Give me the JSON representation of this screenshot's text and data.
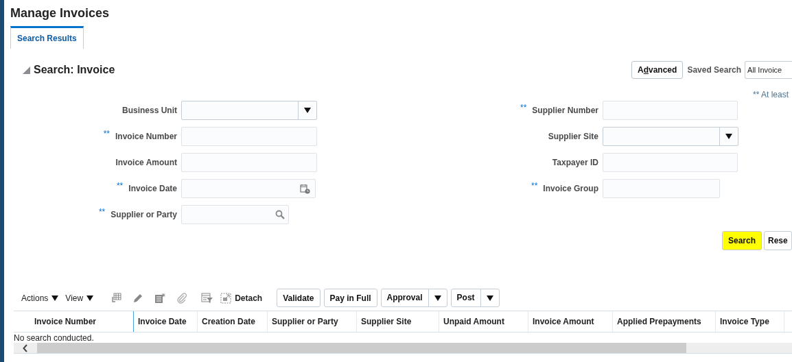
{
  "page_title": "Manage Invoices",
  "tabs": [
    {
      "label": "Search Results",
      "selected": true
    }
  ],
  "search": {
    "title": "Search: Invoice",
    "expanded": true,
    "advanced_button": "Advanced",
    "saved_search_label": "Saved Search",
    "saved_search_value": "All Invoice",
    "hint": "** At least"
  },
  "left_fields": [
    {
      "label": "Business Unit",
      "kind": "select"
    },
    {
      "label": "Invoice Number",
      "kind": "text",
      "required_mark": "**"
    },
    {
      "label": "Invoice Amount",
      "kind": "text"
    },
    {
      "label": "Invoice Date",
      "kind": "date",
      "required_mark": "**"
    },
    {
      "label": "Supplier or Party",
      "kind": "search",
      "required_mark": "**"
    }
  ],
  "right_fields": [
    {
      "label": "Supplier Number",
      "kind": "text",
      "required_mark": "**"
    },
    {
      "label": "Supplier Site",
      "kind": "select"
    },
    {
      "label": "Taxpayer ID",
      "kind": "text"
    },
    {
      "label": "Invoice Group",
      "kind": "text",
      "required_mark": "**"
    }
  ],
  "search_buttons": [
    {
      "label": "Search",
      "highlighted": true
    },
    {
      "label": "Rese",
      "highlighted": false
    }
  ],
  "toolbar": {
    "menus": [
      "Actions",
      "View"
    ],
    "detach": "Detach",
    "buttons": [
      {
        "label": "Validate",
        "kind": "plain"
      },
      {
        "label": "Pay in Full",
        "kind": "plain"
      },
      {
        "label": "Approval",
        "kind": "split"
      },
      {
        "label": "Post",
        "kind": "split"
      }
    ]
  },
  "table": {
    "columns": [
      "Invoice Number",
      "Invoice Date",
      "Creation Date",
      "Supplier or Party",
      "Supplier Site",
      "Unpaid Amount",
      "Invoice Amount",
      "Applied Prepayments",
      "Invoice Type"
    ],
    "empty_message": "No search conducted."
  }
}
